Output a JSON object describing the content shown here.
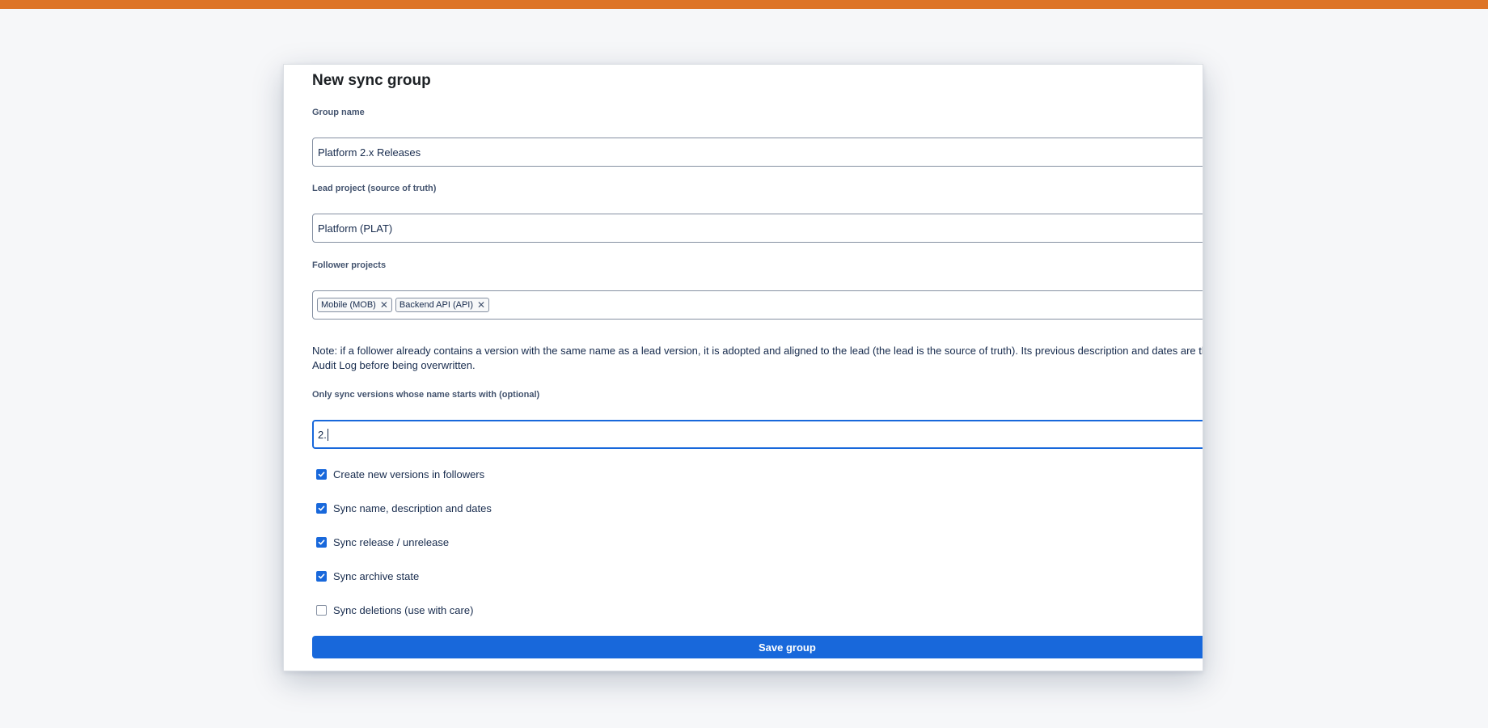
{
  "dialog": {
    "title": "New sync group",
    "group_name": {
      "label": "Group name",
      "value": "Platform 2.x Releases"
    },
    "lead_project": {
      "label": "Lead project (source of truth)",
      "value": "Platform (PLAT)"
    },
    "followers": {
      "label": "Follower projects",
      "tags": [
        {
          "label": "Mobile (MOB)",
          "remove_icon": "close-icon"
        },
        {
          "label": "Backend API (API)",
          "remove_icon": "close-icon"
        }
      ]
    },
    "note": "Note: if a follower already contains a version with the same name as a lead version, it is adopted and aligned to the lead (the lead is the source of truth). Its previous description and dates are the Audit Log before being overwritten.",
    "prefix": {
      "label": "Only sync versions whose name starts with (optional)",
      "value": "2."
    },
    "options": [
      {
        "label": "Create new versions in followers",
        "checked": true
      },
      {
        "label": "Sync name, description and dates",
        "checked": true
      },
      {
        "label": "Sync release / unrelease",
        "checked": true
      },
      {
        "label": "Sync archive state",
        "checked": true
      },
      {
        "label": "Sync deletions (use with care)",
        "checked": false
      }
    ],
    "save_label": "Save group"
  },
  "colors": {
    "top_bar": "#dd7427",
    "accent": "#1868db"
  }
}
